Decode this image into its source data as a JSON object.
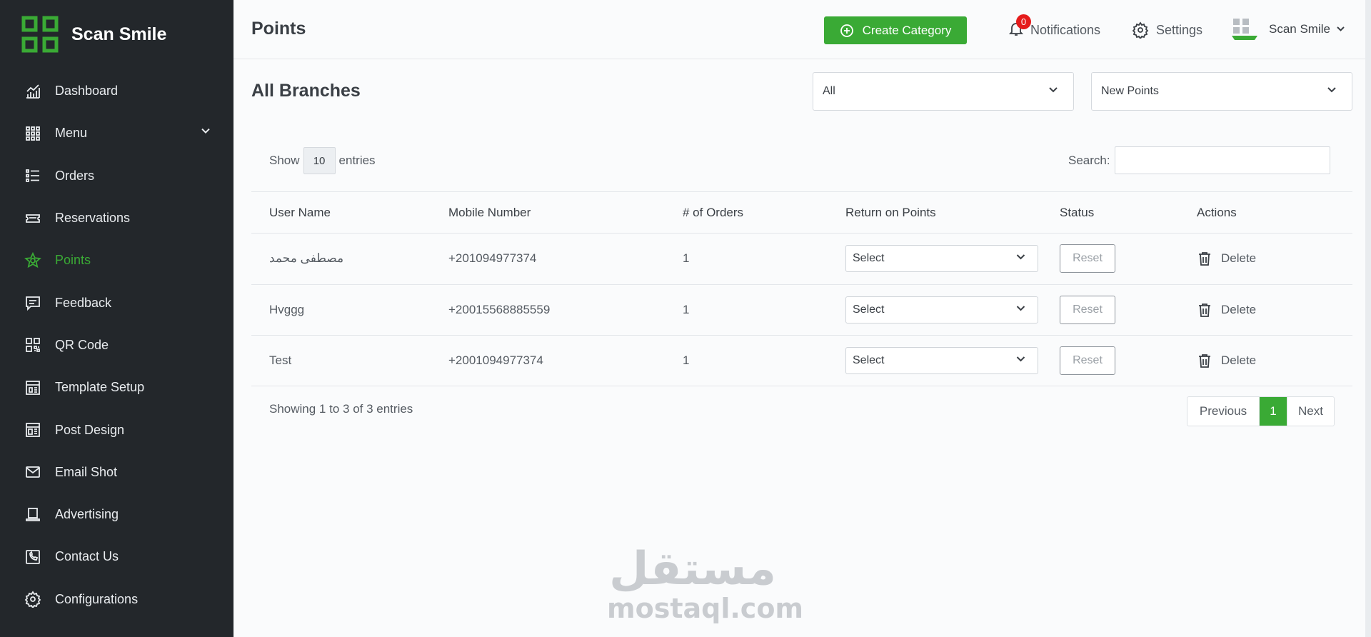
{
  "brand": {
    "name": "Scan Smile"
  },
  "sidebar": {
    "items": [
      {
        "label": "Dashboard",
        "icon": "dashboard-chart-icon",
        "active": false
      },
      {
        "label": "Menu",
        "icon": "grid-icon",
        "active": false,
        "has_submenu": true
      },
      {
        "label": "Orders",
        "icon": "list-icon",
        "active": false
      },
      {
        "label": "Reservations",
        "icon": "ticket-icon",
        "active": false
      },
      {
        "label": "Points",
        "icon": "star-icon",
        "active": true
      },
      {
        "label": "Feedback",
        "icon": "message-icon",
        "active": false
      },
      {
        "label": "QR Code",
        "icon": "qr-code-icon",
        "active": false
      },
      {
        "label": "Template Setup",
        "icon": "template-icon",
        "active": false
      },
      {
        "label": "Post Design",
        "icon": "layout-icon",
        "active": false
      },
      {
        "label": "Email Shot",
        "icon": "mail-icon",
        "active": false
      },
      {
        "label": "Advertising",
        "icon": "laptop-icon",
        "active": false
      },
      {
        "label": "Contact Us",
        "icon": "phone-icon",
        "active": false
      },
      {
        "label": "Configurations",
        "icon": "gear-icon",
        "active": false
      }
    ]
  },
  "header": {
    "title": "Points",
    "create_button": "Create Category",
    "notifications_label": "Notifications",
    "notifications_count": "0",
    "settings_label": "Settings",
    "user_name": "Scan Smile"
  },
  "main": {
    "section_title": "All Branches",
    "branch_filter": "All",
    "points_filter": "New Points",
    "show_label": "Show",
    "entries_value": "10",
    "entries_label": "entries",
    "search_label": "Search:",
    "search_value": "",
    "columns": [
      "User Name",
      "Mobile Number",
      "# of Orders",
      "Return on Points",
      "Status",
      "Actions"
    ],
    "rows": [
      {
        "user": "مصطفى محمد",
        "mobile": "+201094977374",
        "orders": "1",
        "return": "Select",
        "status": "Reset",
        "action": "Delete"
      },
      {
        "user": "Hvggg",
        "mobile": "+20015568885559",
        "orders": "1",
        "return": "Select",
        "status": "Reset",
        "action": "Delete"
      },
      {
        "user": "Test",
        "mobile": "+2001094977374",
        "orders": "1",
        "return": "Select",
        "status": "Reset",
        "action": "Delete"
      }
    ],
    "info": "Showing 1 to 3 of 3 entries",
    "pagination": {
      "previous": "Previous",
      "current": "1",
      "next": "Next"
    }
  },
  "watermark": {
    "arabic": "مستقل",
    "latin": "mostaql.com"
  },
  "colors": {
    "accent": "#3aaa35",
    "sidebar_bg": "#23272b",
    "badge": "#e51b1b"
  }
}
